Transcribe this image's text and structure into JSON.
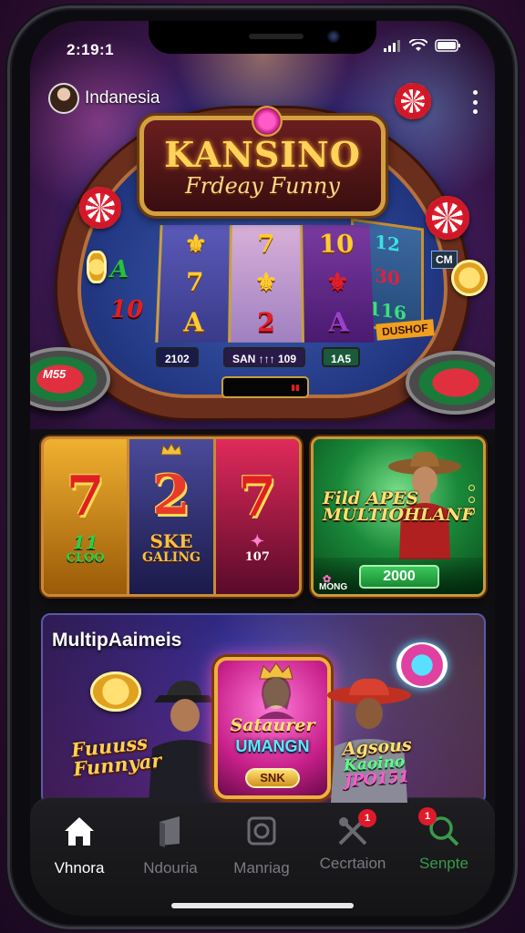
{
  "status_bar": {
    "time": "2:19:1"
  },
  "profile": {
    "name": "Indanesia"
  },
  "hero": {
    "logo_title": "KANSINO",
    "logo_subtitle": "Frdeay Funny",
    "left_symbols": [
      "A",
      "10"
    ],
    "reels": [
      [
        "⚜",
        "7",
        "A"
      ],
      [
        "7",
        "⚜",
        "2"
      ],
      [
        "10",
        "⚜",
        "A"
      ]
    ],
    "side_symbols": [
      "12",
      "30",
      "116"
    ],
    "side_label": "DUSHOF",
    "side_tag": "CM",
    "bet_chips": [
      "2102",
      "SAN ↑↑↑ 109",
      "1A5"
    ],
    "table_label": "M55"
  },
  "slots_tile": {
    "col1": {
      "symbol": "7",
      "sub": "11",
      "sub2": "CLOO"
    },
    "col2": {
      "symbol": "2",
      "sub": "SKE",
      "sub2": "GALING"
    },
    "col3": {
      "symbol": "7",
      "sub": "107"
    }
  },
  "cowboy_tile": {
    "title": "Fild APES MULTIOHLANF",
    "tag": "MONG",
    "value": "2000"
  },
  "multi_tile": {
    "title": "MultipAaimeis",
    "left_promo": "Fuuuss Funnyar",
    "card_title": "Sataurer",
    "card_title2": "UMANGN",
    "card_button": "SNK",
    "right_promo_1": "Agsous",
    "right_promo_2": "Kaoino",
    "right_promo_3": "JPO151"
  },
  "nav": {
    "items": [
      {
        "label": "Vhnora",
        "icon": "home-icon",
        "active": true
      },
      {
        "label": "Ndouria",
        "icon": "bookmark-icon"
      },
      {
        "label": "Manriag",
        "icon": "camera-icon"
      },
      {
        "label": "Cecrtaion",
        "icon": "crossed-tools-icon",
        "badge": "1"
      },
      {
        "label": "Senpte",
        "icon": "search-icon",
        "badge": "1"
      }
    ]
  },
  "colors": {
    "accent_gold": "#d4a040",
    "nav_active": "#ffffff",
    "nav_search": "#3a9a4a",
    "badge": "#e01a2a"
  }
}
